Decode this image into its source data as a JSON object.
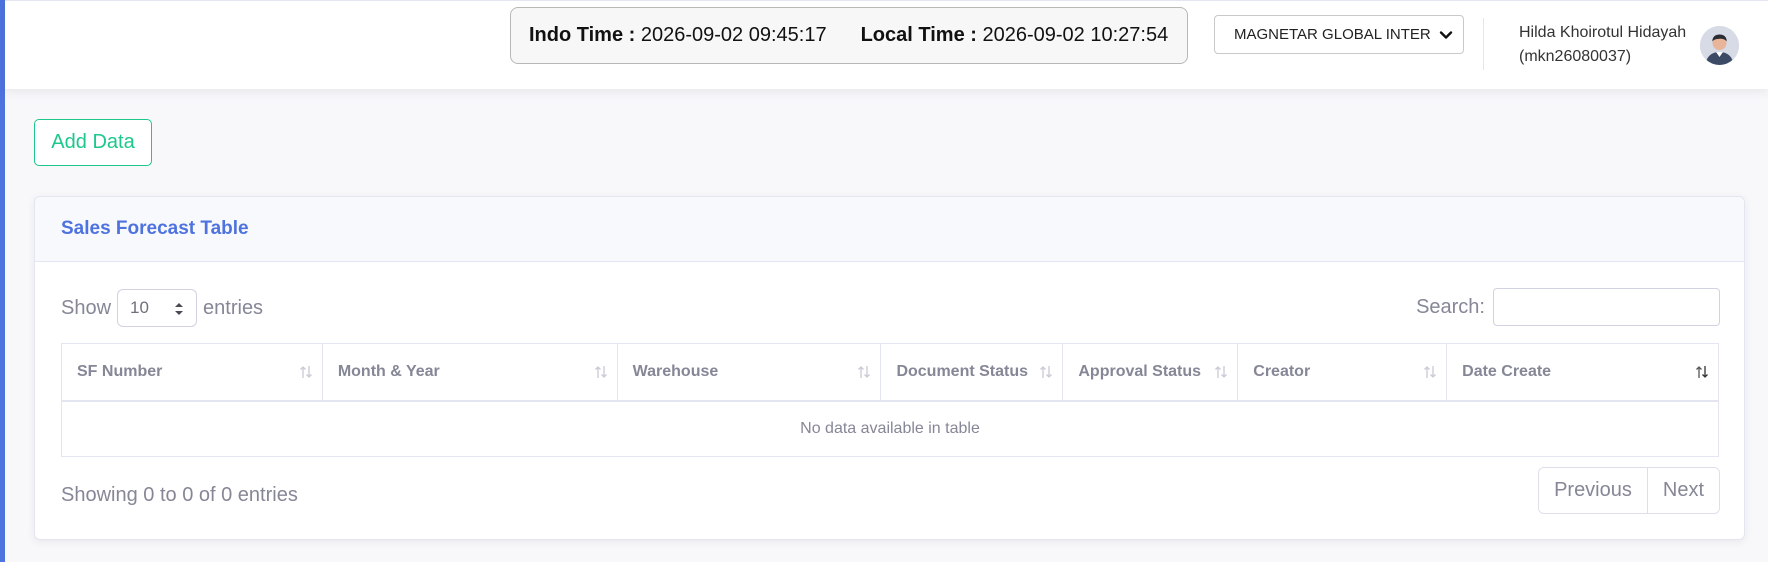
{
  "header": {
    "indo_time_label": "Indo Time :",
    "indo_time_value": "2026-09-02 09:45:17",
    "local_time_label": "Local Time :",
    "local_time_value": "2026-09-02 10:27:54",
    "company_select_value": "MAGNETAR GLOBAL INTER",
    "user_name": "Hilda Khoirotul Hidayah",
    "user_id": "(mkn26080037)"
  },
  "toolbar": {
    "add_label": "Add Data"
  },
  "card": {
    "title": "Sales Forecast Table",
    "show_label": "Show",
    "entries_value": "10",
    "entries_label": "entries",
    "search_label": "Search:",
    "search_value": "",
    "columns": [
      "SF Number",
      "Month & Year",
      "Warehouse",
      "Document Status",
      "Approval Status",
      "Creator",
      "Date Create"
    ],
    "empty_text": "No data available in table",
    "info_text": "Showing 0 to 0 of 0 entries",
    "prev_label": "Previous",
    "next_label": "Next"
  },
  "colors": {
    "accent": "#4e73df",
    "success": "#1cc88a",
    "muted_text": "#858796"
  }
}
